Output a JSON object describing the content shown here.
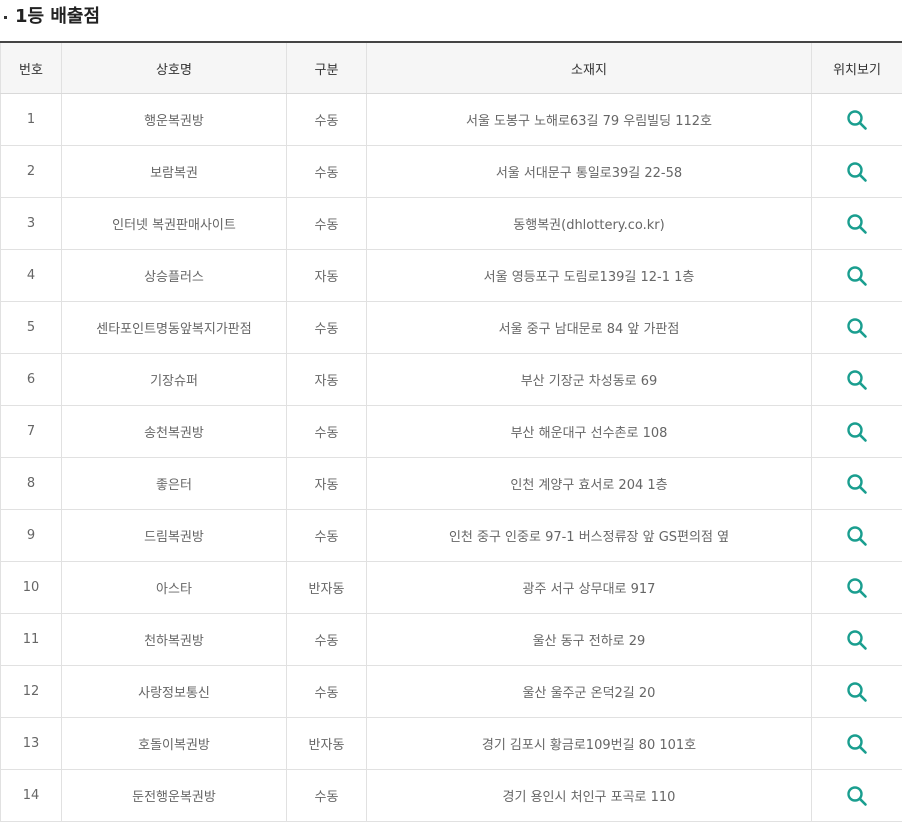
{
  "section": {
    "title": "1등 배출점"
  },
  "table": {
    "headers": {
      "no": "번호",
      "name": "상호명",
      "type": "구분",
      "address": "소재지",
      "location": "위치보기"
    },
    "rows": [
      {
        "no": "1",
        "name": "행운복권방",
        "type": "수동",
        "address": "서울 도봉구 노해로63길 79 우림빌딩 112호"
      },
      {
        "no": "2",
        "name": "보람복권",
        "type": "수동",
        "address": "서울 서대문구 통일로39길 22-58"
      },
      {
        "no": "3",
        "name": "인터넷 복권판매사이트",
        "type": "수동",
        "address": "동행복권(dhlottery.co.kr)"
      },
      {
        "no": "4",
        "name": "상승플러스",
        "type": "자동",
        "address": "서울 영등포구 도림로139길 12-1 1층"
      },
      {
        "no": "5",
        "name": "센타포인트명동앞복지가판점",
        "type": "수동",
        "address": "서울 중구 남대문로 84 앞 가판점"
      },
      {
        "no": "6",
        "name": "기장슈퍼",
        "type": "자동",
        "address": "부산 기장군 차성동로 69"
      },
      {
        "no": "7",
        "name": "송천복권방",
        "type": "수동",
        "address": "부산 해운대구 선수촌로 108"
      },
      {
        "no": "8",
        "name": "좋은터",
        "type": "자동",
        "address": "인천 계양구 효서로 204 1층"
      },
      {
        "no": "9",
        "name": "드림복권방",
        "type": "수동",
        "address": "인천 중구 인중로 97-1 버스정류장 앞 GS편의점 옆"
      },
      {
        "no": "10",
        "name": "아스타",
        "type": "반자동",
        "address": "광주 서구 상무대로 917"
      },
      {
        "no": "11",
        "name": "천하복권방",
        "type": "수동",
        "address": "울산 동구 전하로 29"
      },
      {
        "no": "12",
        "name": "사랑정보통신",
        "type": "수동",
        "address": "울산 울주군 온덕2길 20"
      },
      {
        "no": "13",
        "name": "호돌이복권방",
        "type": "반자동",
        "address": "경기 김포시 황금로109번길 80 101호"
      },
      {
        "no": "14",
        "name": "둔전행운복권방",
        "type": "수동",
        "address": "경기 용인시 처인구 포곡로 110"
      }
    ]
  },
  "colors": {
    "search_icon": "#1a9e8f",
    "header_border": "#444444"
  },
  "icons": {
    "location": "search-icon"
  }
}
